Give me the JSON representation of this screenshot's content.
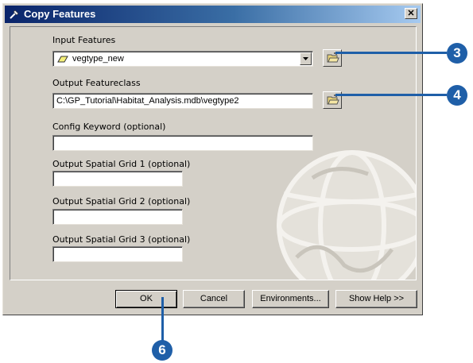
{
  "window": {
    "title": "Copy Features",
    "close_label": "✕"
  },
  "form": {
    "input_features": {
      "label": "Input Features",
      "value": "vegtype_new"
    },
    "output_featureclass": {
      "label": "Output Featureclass",
      "value": "C:\\GP_Tutorial\\Habitat_Analysis.mdb\\vegtype2"
    },
    "config_keyword": {
      "label": "Config Keyword (optional)",
      "value": ""
    },
    "grid1": {
      "label": "Output Spatial Grid 1 (optional)",
      "value": ""
    },
    "grid2": {
      "label": "Output Spatial Grid 2 (optional)",
      "value": ""
    },
    "grid3": {
      "label": "Output Spatial Grid 3 (optional)",
      "value": ""
    }
  },
  "buttons": {
    "ok": "OK",
    "cancel": "Cancel",
    "environments": "Environments...",
    "show_help": "Show Help >>"
  },
  "callouts": {
    "input_browse": "3",
    "output_browse": "4",
    "ok": "6"
  },
  "colors": {
    "callout": "#1f5fa8",
    "dialog": "#d4d0c8",
    "title_start": "#0a246a"
  }
}
